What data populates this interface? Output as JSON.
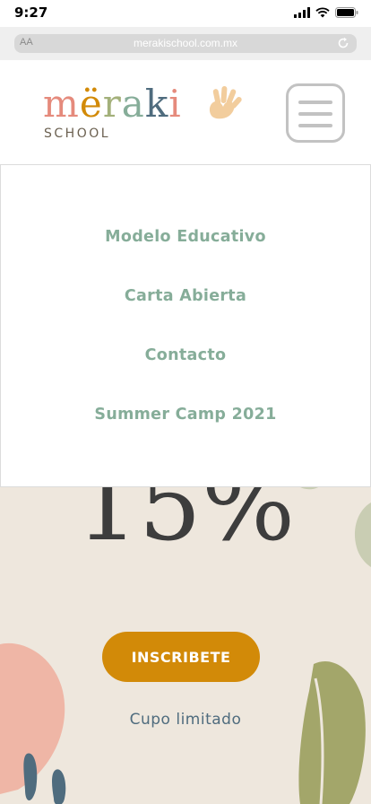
{
  "status_bar": {
    "time": "9:27"
  },
  "browser": {
    "text_size_label": "AA",
    "url": "merakischool.com.mx"
  },
  "logo": {
    "letters": [
      {
        "char": "m",
        "color": "#e58a7c"
      },
      {
        "char": "ë",
        "color": "#d28a08"
      },
      {
        "char": "r",
        "color": "#a3b07a"
      },
      {
        "char": "a",
        "color": "#86ad99"
      },
      {
        "char": "k",
        "color": "#4f6c7e"
      },
      {
        "char": "i",
        "color": "#e58a7c"
      }
    ],
    "subtitle": "SCHOOL",
    "hand_color": "#f2cd9d"
  },
  "nav": {
    "items": [
      {
        "label": "Modelo Educativo"
      },
      {
        "label": "Carta Abierta"
      },
      {
        "label": "Contacto"
      },
      {
        "label": "Summer Camp 2021"
      }
    ]
  },
  "hero": {
    "discount": "15%",
    "cta_label": "INSCRIBETE",
    "note": "Cupo limitado"
  },
  "colors": {
    "accent": "#d28a08",
    "nav_text": "#86ad99",
    "hero_bg": "#eee7dd",
    "note_text": "#4f6c7e"
  }
}
